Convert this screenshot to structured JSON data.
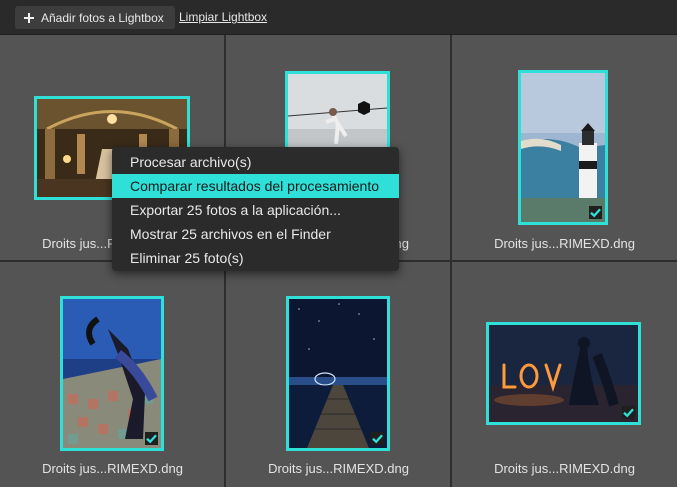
{
  "toolbar": {
    "add_label": "Añadir fotos a Lightbox",
    "clear_label": "Limpiar Lightbox"
  },
  "tiles": [
    {
      "caption": "Droits jus...RIMEXD.dng",
      "selected": false,
      "scene": "opera-hall"
    },
    {
      "caption": "Droits jus...RIMEXD.dng",
      "selected": false,
      "scene": "rope-jump"
    },
    {
      "caption": "Droits jus...RIMEXD.dng",
      "selected": true,
      "scene": "lighthouse"
    },
    {
      "caption": "Droits jus...RIMEXD.dng",
      "selected": true,
      "scene": "dancer-tiles"
    },
    {
      "caption": "Droits jus...RIMEXD.dng",
      "selected": true,
      "scene": "night-pier"
    },
    {
      "caption": "Droits jus...RIMEXD.dng",
      "selected": true,
      "scene": "love-lights"
    }
  ],
  "context_menu": {
    "items": [
      {
        "label": "Procesar archivo(s)",
        "active": false
      },
      {
        "label": "Comparar resultados del procesamiento",
        "active": true
      },
      {
        "label": "Exportar 25 fotos a la aplicación...",
        "active": false
      },
      {
        "label": "Mostrar 25 archivos en el Finder",
        "active": false
      },
      {
        "label": "Eliminar 25 foto(s)",
        "active": false
      }
    ]
  },
  "colors": {
    "accent": "#2ee0d8",
    "cell_bg": "#545454",
    "toolbar_bg": "#2a2a2a",
    "menu_bg": "#2b2b2b"
  }
}
